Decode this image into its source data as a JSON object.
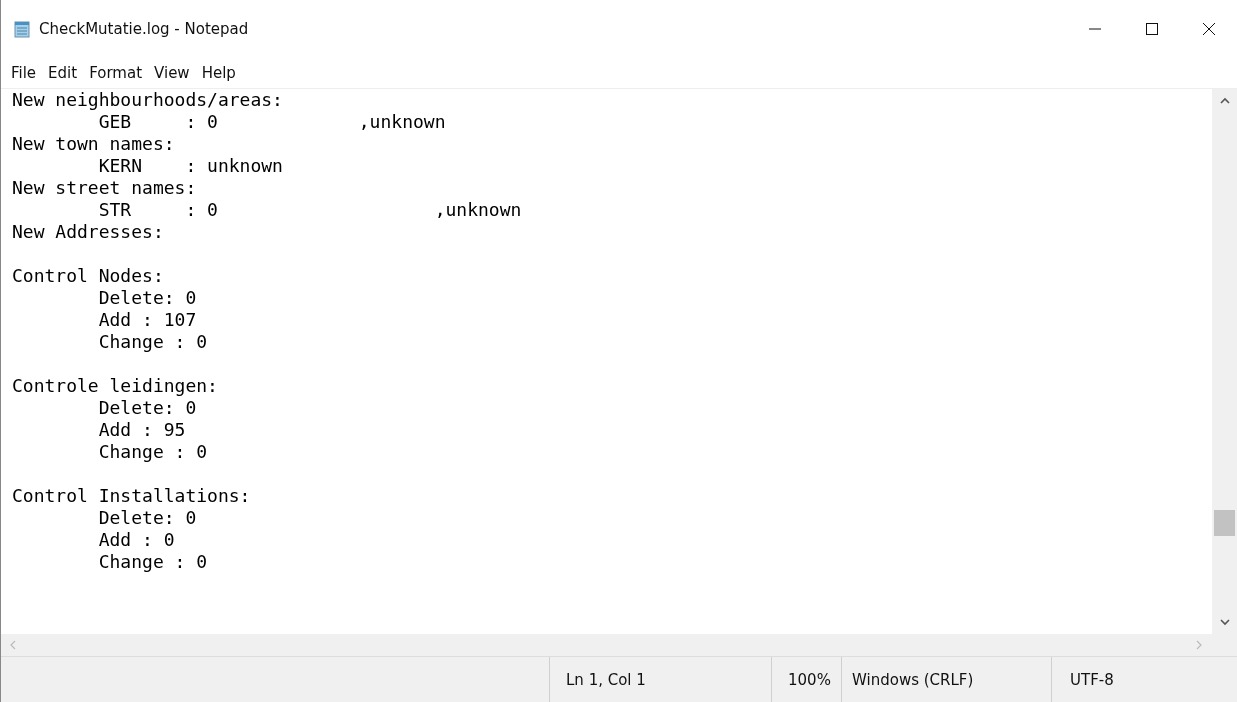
{
  "window": {
    "title": "CheckMutatie.log - Notepad"
  },
  "menu": [
    "File",
    "Edit",
    "Format",
    "View",
    "Help"
  ],
  "document": {
    "sections": [
      [
        "New neighbourhoods/areas:",
        "        GEB     : 0             ,unknown",
        "New town names:",
        "        KERN    : unknown",
        "New street names:",
        "        STR     : 0                    ,unknown",
        "New Addresses:"
      ],
      [
        "Control Nodes:",
        "        Delete: 0",
        "        Add : 107",
        "        Change : 0"
      ],
      [
        "Controle leidingen:",
        "        Delete: 0",
        "        Add : 95",
        "        Change : 0"
      ],
      [
        "Control Installations:",
        "        Delete: 0",
        "        Add : 0",
        "        Change : 0"
      ]
    ]
  },
  "status_bar": {
    "position": "Ln 1, Col 1",
    "zoom": "100%",
    "line_endings": "Windows (CRLF)",
    "encoding": "UTF-8"
  }
}
